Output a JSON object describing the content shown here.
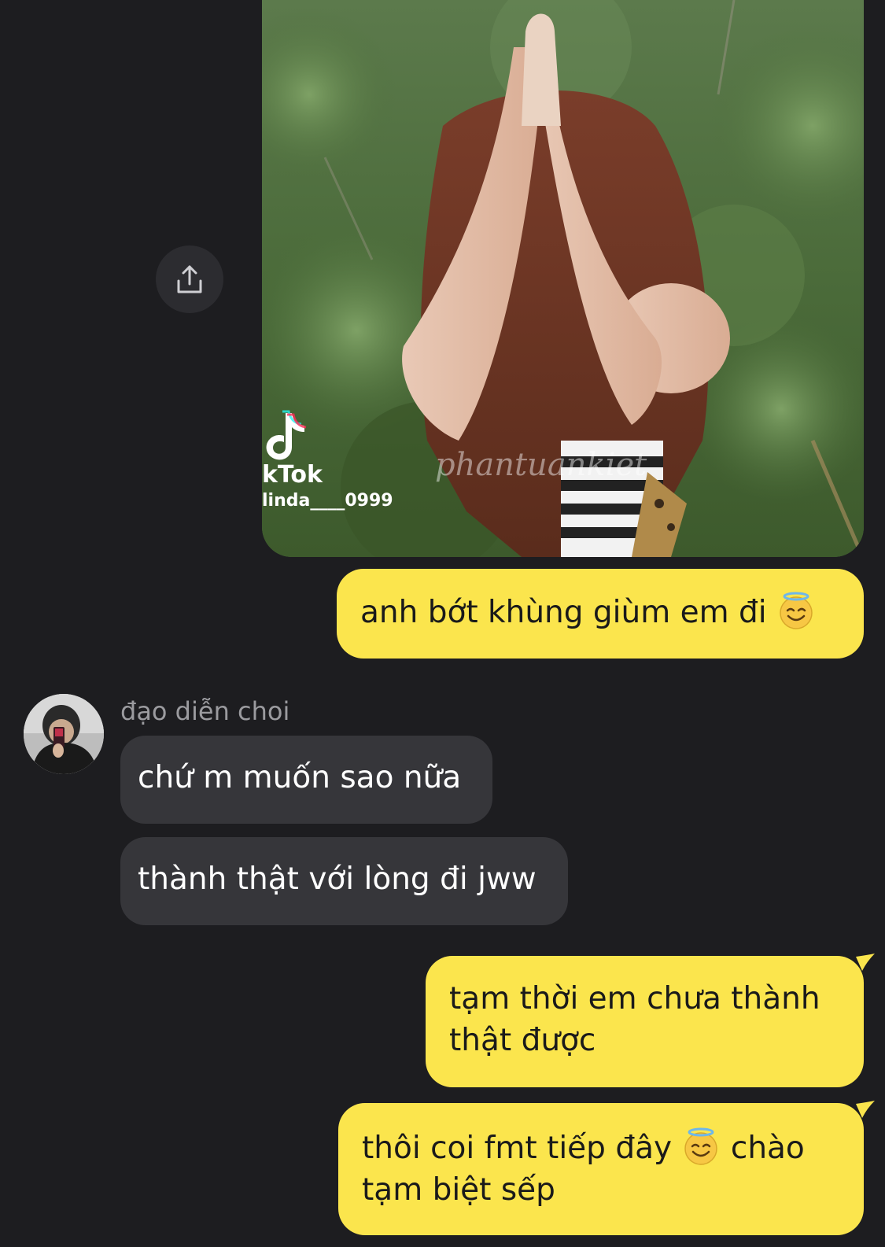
{
  "media": {
    "kind": "video-thumbnail",
    "watermark_brand": "kTok",
    "watermark_user": "linda____0999",
    "overlay_watermark": "phantuankiet"
  },
  "share_button": {
    "icon": "share-icon"
  },
  "messages": [
    {
      "side": "out",
      "text": "anh bớt khùng giùm em đi",
      "emoji": "smiling-face-with-halo"
    },
    {
      "side": "in",
      "sender": "đạo diễn choi",
      "text": "chứ m muốn sao nữa"
    },
    {
      "side": "in",
      "text": "thành thật với lòng đi jww"
    },
    {
      "side": "out",
      "text": "tạm thời em chưa thành thật được"
    },
    {
      "side": "out",
      "text_before": "thôi coi fmt tiếp đây",
      "emoji": "smiling-face-with-halo",
      "text_after": "chào tạm biệt sếp"
    }
  ],
  "colors": {
    "background": "#1d1d20",
    "outgoing_bubble": "#fbe54d",
    "incoming_bubble": "#36363a",
    "sender_name": "#9b9b9f"
  }
}
